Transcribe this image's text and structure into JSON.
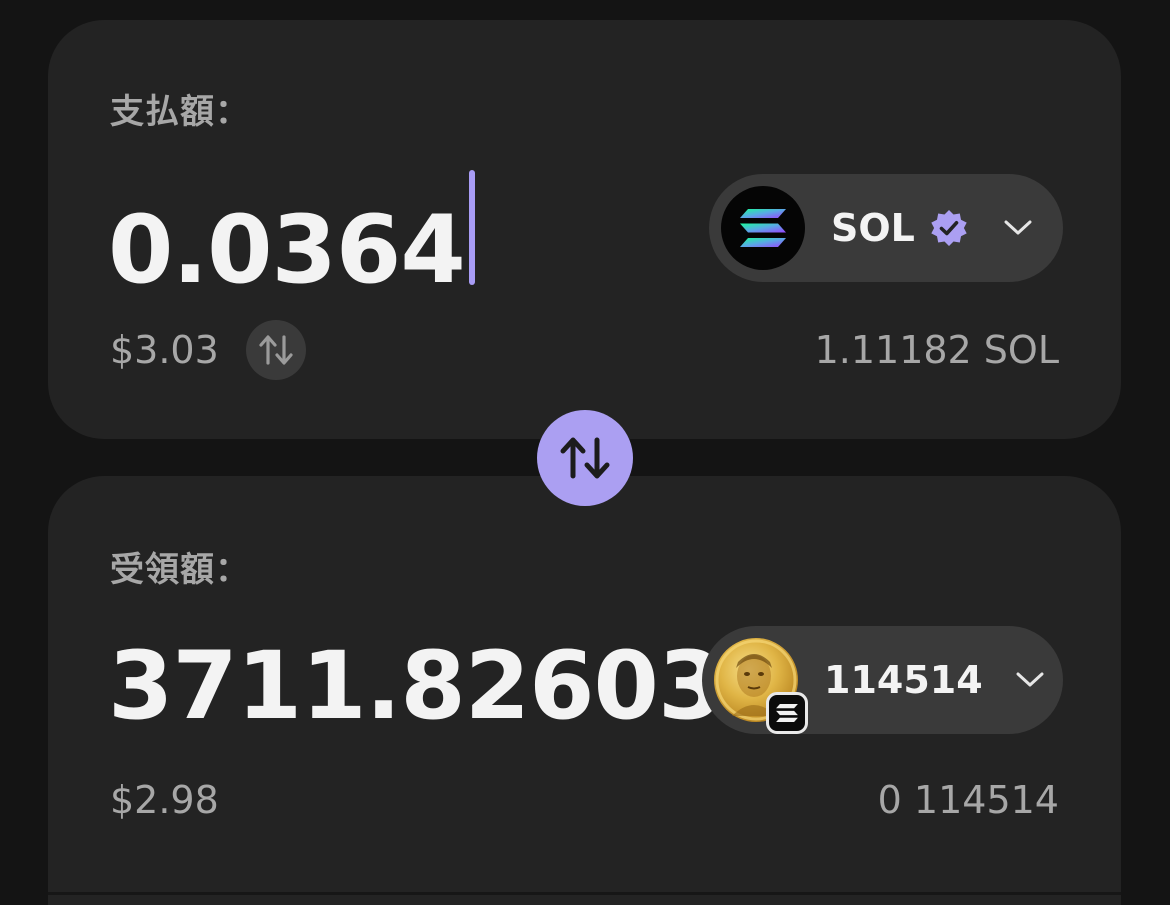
{
  "pay": {
    "label": "支払額：",
    "amount": "0.0364",
    "usd_value": "$3.03",
    "balance": "1.11182 SOL",
    "token": {
      "symbol": "SOL",
      "verified": true,
      "icon": "solana-logo-icon"
    }
  },
  "receive": {
    "label": "受領額：",
    "amount": "3711.82603",
    "usd_value": "$2.98",
    "balance": "0 114514",
    "token": {
      "symbol": "114514",
      "icon": "gold-coin-token-icon",
      "network_badge": "solana-network-icon"
    }
  },
  "swap_button": {
    "icon": "swap-arrows-icon"
  },
  "colors": {
    "background": "#141414",
    "card": "#232323",
    "pill": "#3a3a3a",
    "accent": "#ab9ff2",
    "text_primary": "#f3f3f3",
    "text_secondary": "#a7a7a7"
  }
}
